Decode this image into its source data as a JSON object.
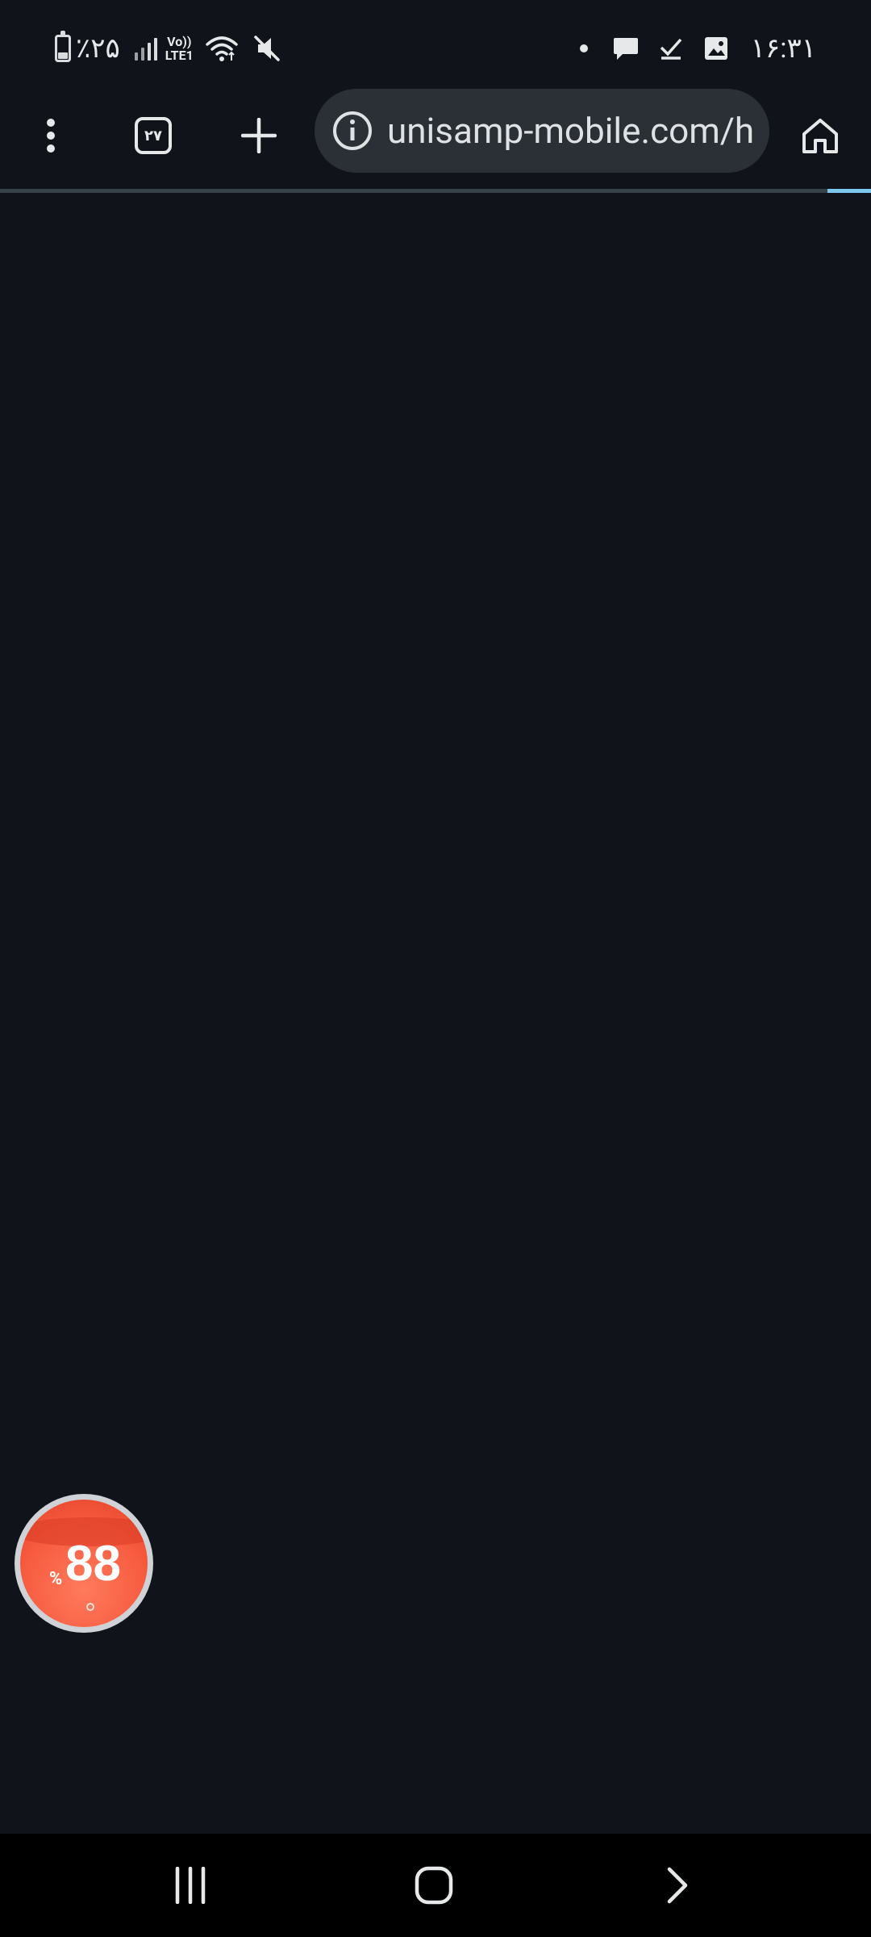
{
  "status_bar": {
    "battery_text": "٪۲۵",
    "lte_line1": "Vo))",
    "lte_line2": "LTE1",
    "time": "۱۶:۳۱",
    "icons": [
      "battery-icon",
      "signal-icon",
      "lte-icon",
      "wifi-icon",
      "mute-icon",
      "notification-dot-icon",
      "message-icon",
      "check-icon",
      "image-icon"
    ]
  },
  "toolbar": {
    "tab_count": "۲۷",
    "url": "unisamp-mobile.com/h",
    "icons": [
      "more-vert-icon",
      "tabs-icon",
      "plus-icon",
      "info-icon",
      "home-icon"
    ],
    "load_progress": 0.95
  },
  "floating_bubble": {
    "value": "88",
    "percent_sign": "%"
  },
  "nav_bar": {
    "icons": [
      "recents-icon",
      "home-nav-icon",
      "back-icon"
    ]
  },
  "colors": {
    "background": "#10141a",
    "url_field": "#2b3036",
    "progress": "#7ec8ef",
    "bubble": "#f65a3e"
  }
}
